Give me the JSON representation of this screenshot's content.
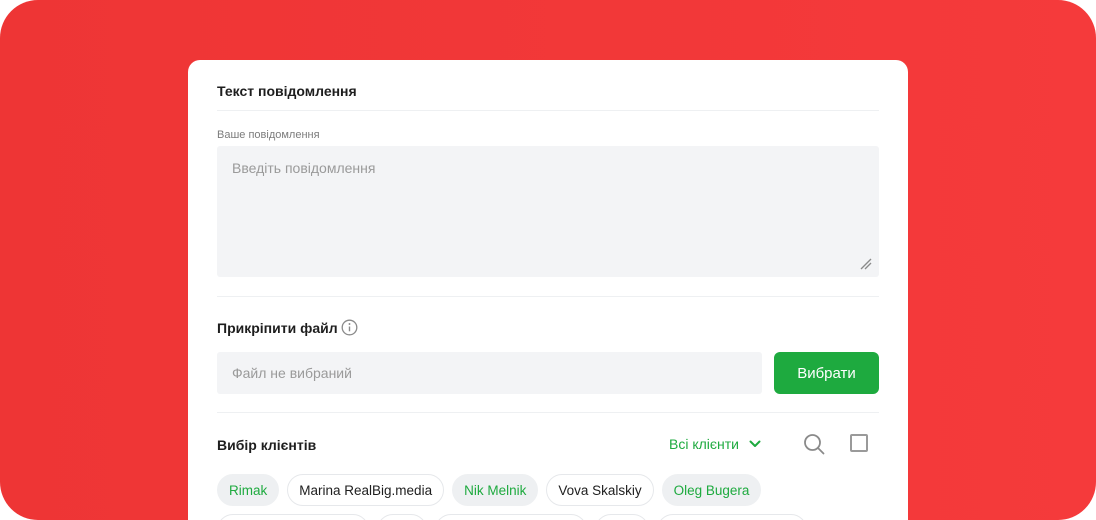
{
  "message": {
    "section_title": "Текст повідомлення",
    "field_label": "Ваше повідомлення",
    "placeholder": "Введіть повідомлення"
  },
  "attach": {
    "section_title": "Прикріпити файл",
    "info_icon": "info-circle-icon",
    "file_placeholder": "Файл не вибраний",
    "choose_label": "Вибрати"
  },
  "clients": {
    "section_title": "Вибір клієнтів",
    "filter_label": "Всі клієнти",
    "filter_icon": "chevron-down-icon",
    "search_icon": "search-icon",
    "chips": [
      {
        "label": "Rimak",
        "selected": true
      },
      {
        "label": "Marina RealBig.media",
        "selected": false
      },
      {
        "label": "Nik Melnik",
        "selected": true
      },
      {
        "label": "Vova Skalskiy",
        "selected": false
      },
      {
        "label": "Oleg Bugera",
        "selected": true
      }
    ]
  },
  "colors": {
    "background": "#f03838",
    "accent": "#1eaa3f",
    "field_bg": "#f3f4f6"
  }
}
